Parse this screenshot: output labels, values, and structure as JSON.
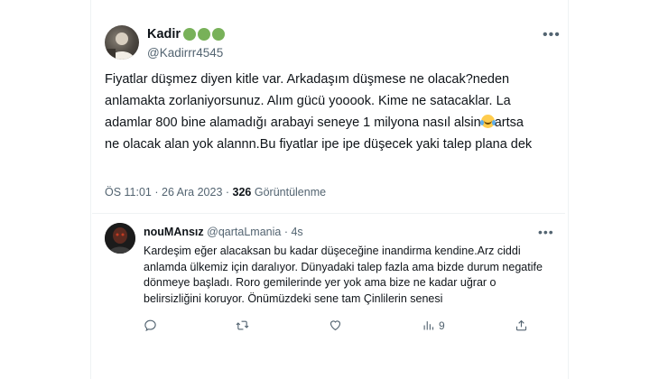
{
  "tweet": {
    "author_name": "Kadir",
    "author_handle": "@Kadirrr4545",
    "text": "Fiyatlar düşmez diyen kitle var. Arkadaşım düşmese ne olacak?neden anlamakta zorlaniyorsunuz. Alım gücü yooook. Kime ne satacaklar. La adamlar 800 bine alamadığı arabayi seneye 1 milyona nasıl alsin",
    "text_after_emoji": "artsa ne olacak alan yok alannn.Bu fiyatlar ipe ipe düşecek yaki talep plana dek",
    "timestamp": "ÖS 11:01 · 26 Ara 2023 · ",
    "views_count": "326",
    "views_label": " Görüntülenme"
  },
  "reply": {
    "author_name": "nouMAnsız",
    "author_handle": "@qartaLmania",
    "time": "· 4s",
    "text": "Kardeşim eğer alacaksan bu kadar düşeceğine inandirma kendine.Arz ciddi anlamda ülkemiz için daralıyor. Dünyadaki talep fazla ama bizde durum negatife dönmeye başladı. Roro gemilerinde yer yok ama bize ne kadar uğrar o belirsizliğini koruyor. Önümüzdeki sene tam Çinlilerin senesi",
    "views_count": "9"
  },
  "icons": {
    "verified_dots_color": "#78b159",
    "reply": "speech-bubble-icon",
    "retweet": "retweet-icon",
    "like": "heart-icon",
    "views": "bar-chart-icon",
    "share": "upload-icon",
    "more": "more-dots-icon"
  }
}
